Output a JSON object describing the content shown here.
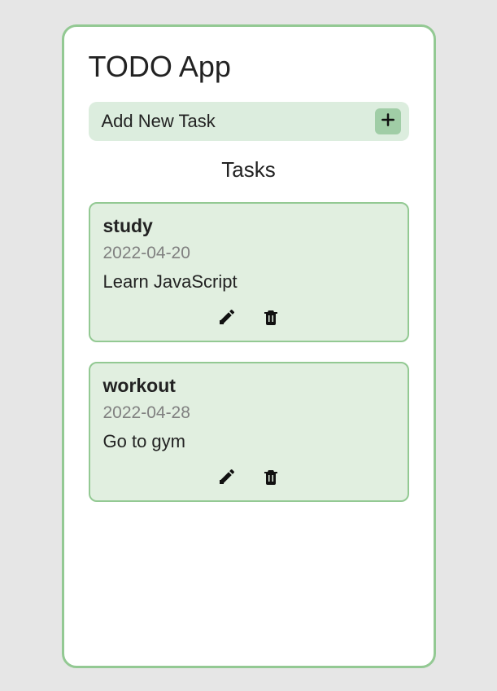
{
  "app": {
    "title": "TODO App"
  },
  "addTask": {
    "label": "Add New Task"
  },
  "tasksSection": {
    "heading": "Tasks"
  },
  "tasks": [
    {
      "title": "study",
      "date": "2022-04-20",
      "description": "Learn JavaScript"
    },
    {
      "title": "workout",
      "date": "2022-04-28",
      "description": "Go to gym"
    }
  ]
}
